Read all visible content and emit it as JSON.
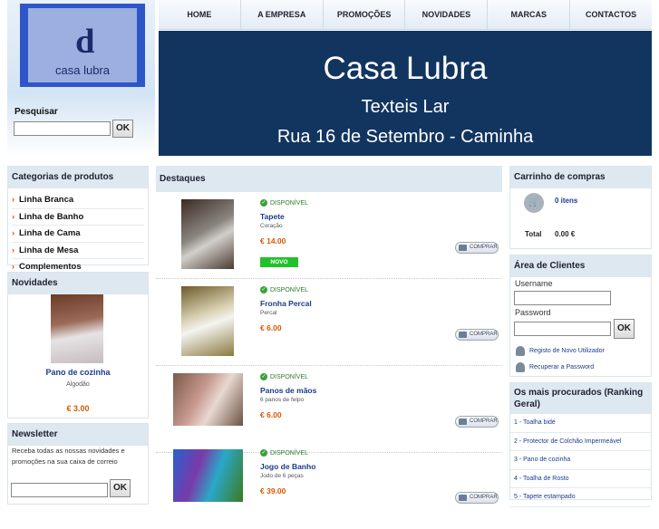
{
  "logo": {
    "text": "casa lubra"
  },
  "search": {
    "label": "Pesquisar",
    "value": "",
    "button": "OK"
  },
  "nav": {
    "items": [
      "HOME",
      "A EMPRESA",
      "PROMOÇÕES",
      "NOVIDADES",
      "MARCAS",
      "CONTACTOS"
    ]
  },
  "banner": {
    "line1": "Casa Lubra",
    "line2": "Texteis Lar",
    "line3": "Rua 16 de Setembro -  Caminha"
  },
  "categories": {
    "title": "Categorias de produtos",
    "items": [
      "Linha Branca",
      "Linha de Banho",
      "Linha de Cama",
      "Linha de Mesa",
      "Complementos"
    ]
  },
  "novidades": {
    "title": "Novidades",
    "name": "Pano de cozinha",
    "desc": "Algodão",
    "price": "€ 3.00"
  },
  "newsletter": {
    "title": "Newsletter",
    "text": "Receba todas as nossas novidades e promoções na sua caixa de correio",
    "button": "OK",
    "value": ""
  },
  "main": {
    "title": "Destaques",
    "products": [
      {
        "avail": "DISPONÍVEL",
        "name": "Tapete",
        "desc": "Coração",
        "price": "€ 14.00",
        "badge": "NOVO",
        "buy": "COMPRAR"
      },
      {
        "avail": "DISPONÍVEL",
        "name": "Fronha Percal",
        "desc": "Percal",
        "price": "€ 6.00",
        "buy": "COMPRAR"
      },
      {
        "avail": "DISPONÍVEL",
        "name": "Panos de mãos",
        "desc": "6 panos de felpo",
        "price": "€ 6.00",
        "buy": "COMPRAR"
      },
      {
        "avail": "DISPONÍVEL",
        "name": "Jogo de Banho",
        "desc": "Jodo de 6 peças",
        "price": "€ 39.00",
        "buy": "COMPRAR"
      }
    ]
  },
  "cart": {
    "title": "Carrinho de compras",
    "items": "0 itens",
    "total_label": "Total",
    "total_value": "0.00 €"
  },
  "client": {
    "title": "Área de Clientes",
    "username_label": "Username",
    "password_label": "Password",
    "button": "OK",
    "register": "Registo de Novo Utilizador",
    "recover": "Recuperar a Password"
  },
  "ranking": {
    "title": "Os mais procurados (Ranking Geral)",
    "items": [
      "1 - Toalha bidé",
      "2 - Protector de Colchão Impermeável",
      "3 - Pano de cozinha",
      "4 - Toalha de Rosto",
      "5 - Tapete estampado"
    ]
  }
}
